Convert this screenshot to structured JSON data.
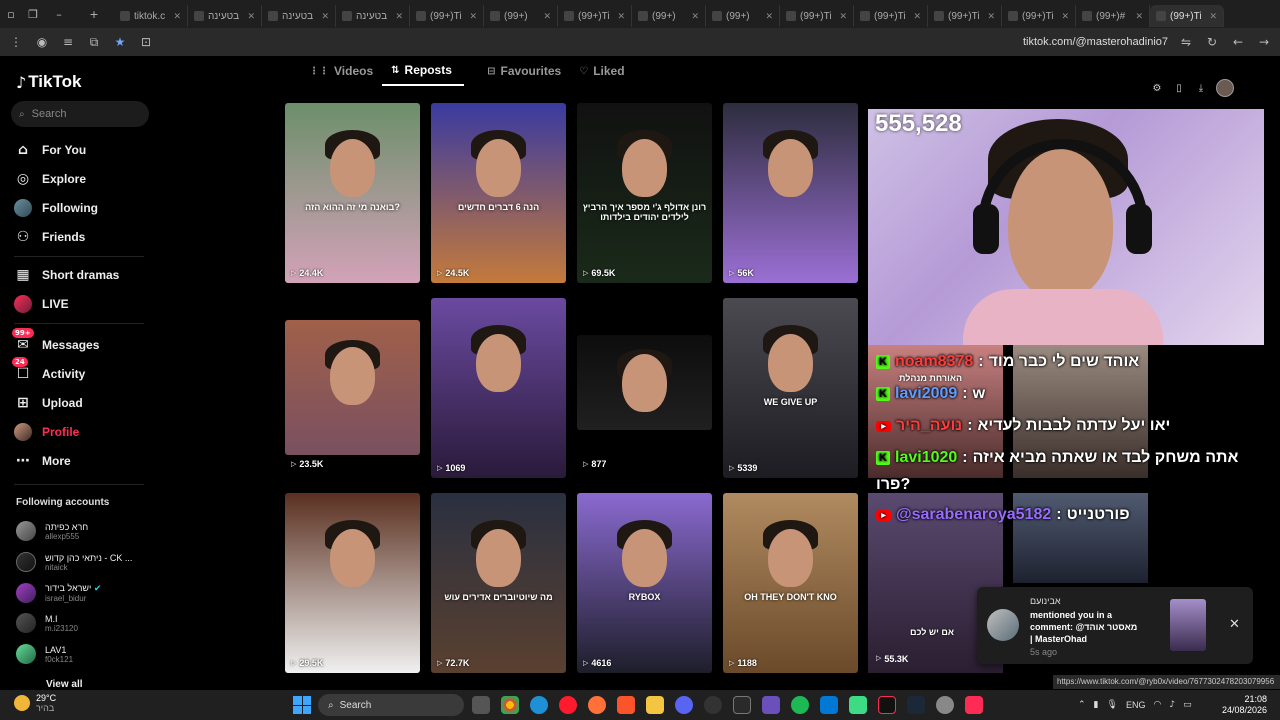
{
  "browser": {
    "tabs": [
      {
        "label": "tiktok.c"
      },
      {
        "label": "בטעינה"
      },
      {
        "label": "בטעינה"
      },
      {
        "label": "בטעינה"
      },
      {
        "label": "(99+)Ti"
      },
      {
        "label": "(99+)"
      },
      {
        "label": "(99+)Ti"
      },
      {
        "label": "(99+)"
      },
      {
        "label": "(99+)"
      },
      {
        "label": "(99+)Ti"
      },
      {
        "label": "(99+)Ti"
      },
      {
        "label": "(99+)Ti"
      },
      {
        "label": "(99+)Ti"
      },
      {
        "label": "(99+)#"
      },
      {
        "label": "(99+)Ti"
      }
    ],
    "url": "tiktok.com/@masterohadinio7"
  },
  "sidebar": {
    "logo": "TikTok",
    "search_placeholder": "Search",
    "nav": {
      "for_you": "For You",
      "explore": "Explore",
      "following": "Following",
      "friends": "Friends",
      "short_dramas": "Short dramas",
      "live": "LIVE",
      "messages": "Messages",
      "messages_badge": "99+",
      "activity": "Activity",
      "activity_badge": "24",
      "upload": "Upload",
      "profile": "Profile",
      "more": "More"
    },
    "following_title": "Following accounts",
    "following_accounts": [
      {
        "name": "חרא כפיתה",
        "user": "allexp555"
      },
      {
        "name": "ניתאי כהן קדוש - CK ...",
        "user": "nitaick"
      },
      {
        "name": "ישראל בידור",
        "user": "israel_bidur"
      },
      {
        "name": "M.I",
        "user": "m.i23120"
      },
      {
        "name": "LAV1",
        "user": "f0ck121"
      }
    ],
    "view_all": "View all"
  },
  "content_tabs": {
    "videos": "Videos",
    "reposts": "Reposts",
    "favourites": "Favourites",
    "liked": "Liked"
  },
  "videos": [
    {
      "views": "24.4K",
      "overlay": "בואנה מי זה ההוא הזה?"
    },
    {
      "views": "24.5K",
      "overlay": "הנה 6 דברים חדשים"
    },
    {
      "views": "69.5K",
      "overlay": "רונן אדולף ג'י מספר איך הרביץ לילדים יהודים בילדותו"
    },
    {
      "views": "56K",
      "overlay": ""
    },
    {
      "views": "23.5K",
      "overlay": ""
    },
    {
      "views": "1069",
      "overlay": ""
    },
    {
      "views": "877",
      "overlay": ""
    },
    {
      "views": "5339",
      "overlay": "WE GIVE UP"
    },
    {
      "views": "29.5K",
      "overlay": ""
    },
    {
      "views": "72.7K",
      "overlay": "מה שיוטיוברים אדירים עוש"
    },
    {
      "views": "4616",
      "overlay": "RYBOX"
    },
    {
      "views": "1188",
      "overlay": "OH THEY DON'T KNO"
    },
    {
      "views": "55.3K",
      "overlay": "אם יש לכם"
    }
  ],
  "stream": {
    "viewers": "555,528",
    "chat": [
      {
        "user": "noam8378",
        "text": "אוהד שים לי כבר מוד",
        "sep": ":"
      },
      {
        "user": "lavi2009",
        "text": "w",
        "sep": ":"
      },
      {
        "user": "נועה_היר",
        "text": "יאו יעל עדתה לבבות לעדיא",
        "sep": ":"
      },
      {
        "user": "lavi1020",
        "text": "אתה משחק לבד או שאתה מביא איזה",
        "sep": ":"
      },
      {
        "user": "",
        "text": "פרו?",
        "sep": ""
      },
      {
        "user": "@sarabenaroya5182",
        "text": "פורטנייט",
        "sep": ":"
      }
    ],
    "badge_text": "האורחת מנהלת"
  },
  "notification": {
    "user": "אבינועם",
    "text": "mentioned you in a comment: @מאסטר אוהד | MasterOhad",
    "time": "5s ago"
  },
  "status_url": "https://www.tiktok.com/@ryb0x/video/7677302478203079956",
  "taskbar": {
    "temp": "29°C",
    "weather_desc": "בהיר",
    "search": "Search",
    "lang": "ENG",
    "time": "21:08",
    "date": "24/08/2026"
  },
  "colors": {
    "accent": "#fe2c55",
    "kick": "#53fc18",
    "youtube": "#ff0000"
  }
}
